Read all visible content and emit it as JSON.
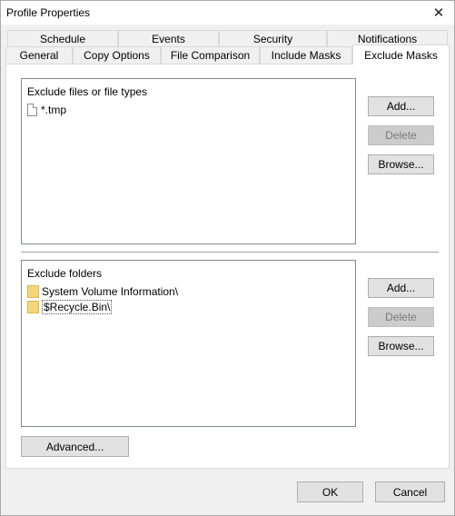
{
  "window": {
    "title": "Profile Properties",
    "close_glyph": "✕"
  },
  "tabs": {
    "row1": [
      "Schedule",
      "Events",
      "Security",
      "Notifications"
    ],
    "row2": [
      "General",
      "Copy Options",
      "File Comparison",
      "Include Masks",
      "Exclude Masks"
    ],
    "active": "Exclude Masks"
  },
  "files_section": {
    "header": "Exclude files or file types",
    "items": [
      {
        "label": "*.tmp",
        "icon": "file-icon"
      }
    ],
    "add_label": "Add...",
    "delete_label": "Delete",
    "browse_label": "Browse..."
  },
  "folders_section": {
    "header": "Exclude folders",
    "items": [
      {
        "label": "System Volume Information\\",
        "icon": "folder-icon"
      },
      {
        "label": "$Recycle.Bin\\",
        "icon": "folder-icon",
        "selected": true
      }
    ],
    "add_label": "Add...",
    "delete_label": "Delete",
    "browse_label": "Browse..."
  },
  "footer": {
    "advanced_label": "Advanced...",
    "ok_label": "OK",
    "cancel_label": "Cancel"
  },
  "colors": {
    "dialog_bg": "#f0f0f0",
    "panel_bg": "#ffffff",
    "folder_yellow": "#f5d57a",
    "disabled_text": "#7a7a7a"
  }
}
